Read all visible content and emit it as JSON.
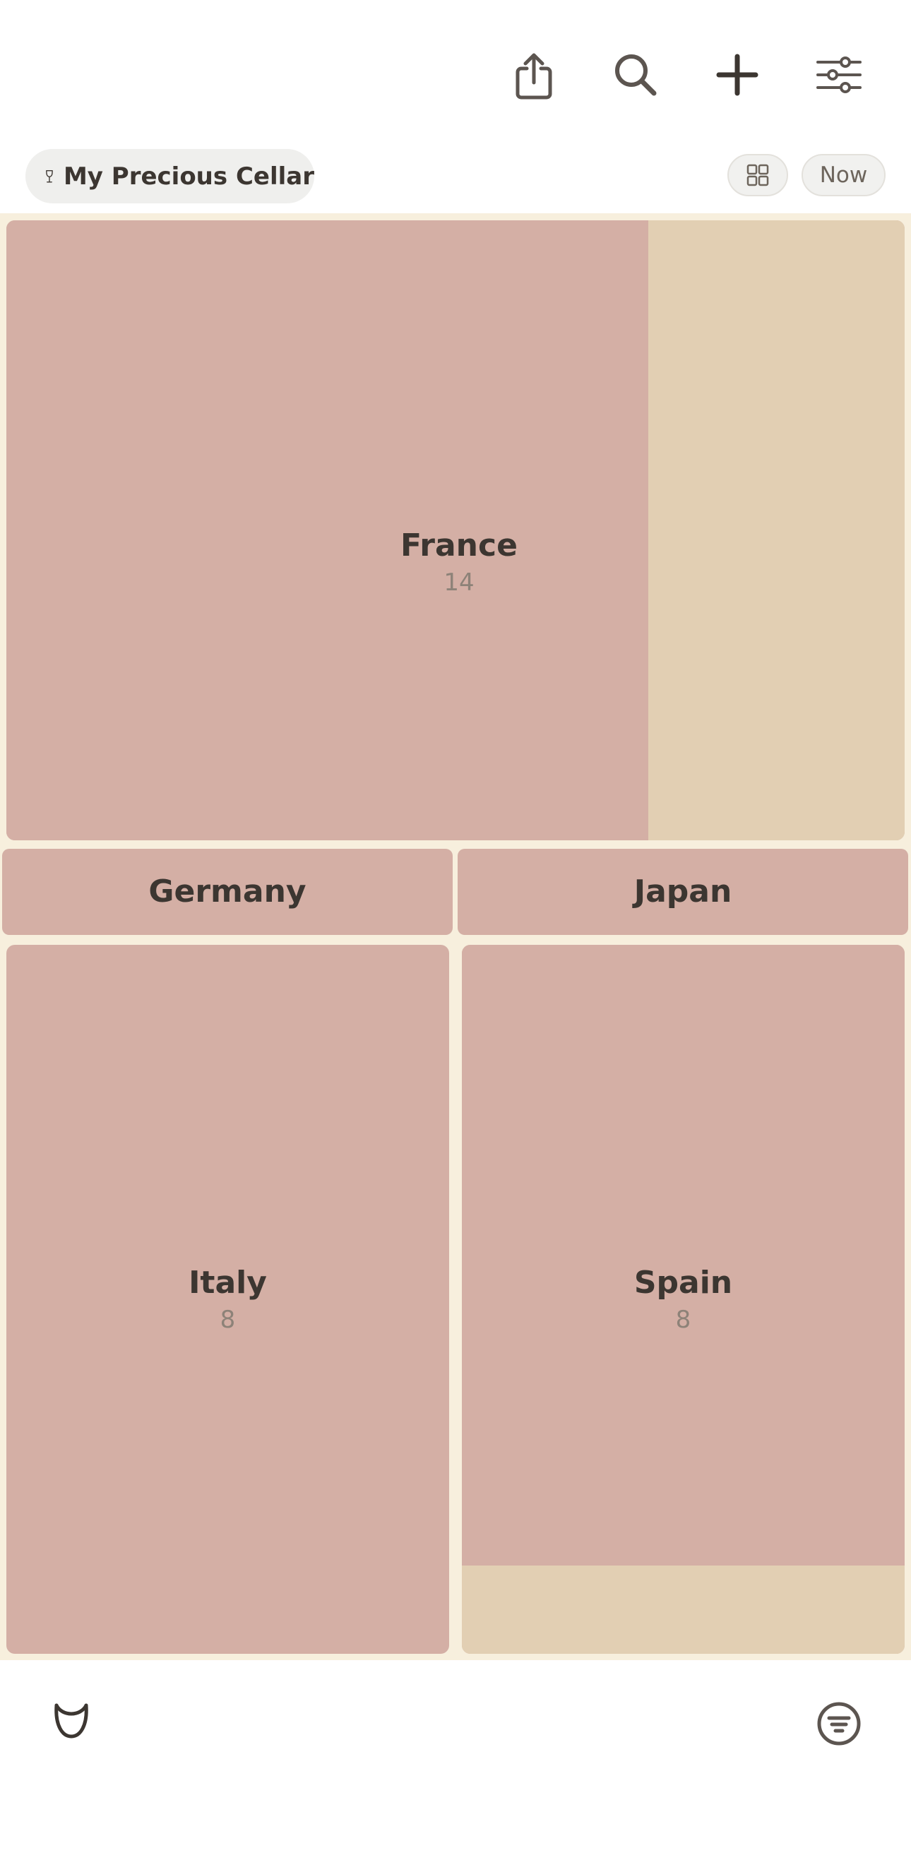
{
  "toolbar": {
    "icons": [
      "share-icon",
      "search-icon",
      "plus-icon",
      "sliders-icon"
    ]
  },
  "cellar": {
    "icon": "wine-glass-icon",
    "name": "My Precious Cellar"
  },
  "view": {
    "grid_icon": "grid-icon",
    "time_label": "Now"
  },
  "colors": {
    "tile": "#d4afa5",
    "tile_remainder": "#e2cfb3",
    "background": "#f7efdd",
    "ink": "#3c3631"
  },
  "regions": [
    {
      "name": "France",
      "count": "14",
      "filled": 0.715
    },
    {
      "name": "Germany",
      "count": "",
      "filled": 1.0
    },
    {
      "name": "Japan",
      "count": "",
      "filled": 1.0
    },
    {
      "name": "Italy",
      "count": "8",
      "filled": 1.0
    },
    {
      "name": "Spain",
      "count": "8",
      "filled": 0.875
    }
  ],
  "bottom_bar": {
    "left_icon": "glass-rim-icon",
    "right_icon": "filter-lines-icon"
  }
}
